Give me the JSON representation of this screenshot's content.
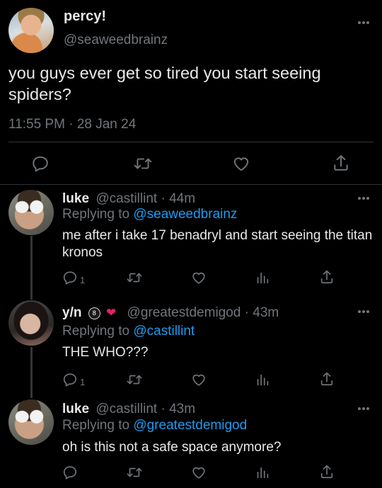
{
  "colors": {
    "background": "#000000",
    "text": "#e7e9ea",
    "muted": "#71767b",
    "link": "#1d9bf0",
    "divider": "#2f3336"
  },
  "main_tweet": {
    "display_name": "percy!",
    "handle": "@seaweedbrainz",
    "text": "you guys ever get so tired you start seeing spiders?",
    "time": "11:55 PM",
    "separator": "·",
    "date": "28 Jan 24",
    "icons": [
      "reply-icon",
      "retweet-icon",
      "like-icon",
      "share-icon"
    ]
  },
  "replies": [
    {
      "display_name": "luke",
      "handle": "@castillint",
      "separator": "·",
      "age": "44m",
      "replying_prefix": "Replying to",
      "replying_to": "@seaweedbrainz",
      "text": "me after i take 17 benadryl and start seeing the titan kronos",
      "reply_count": "1"
    },
    {
      "display_name": "y/n",
      "badge_icons": [
        "8-ball-icon",
        "mending-heart-icon"
      ],
      "badge_glyph": "8",
      "heart_glyph": "❤",
      "handle": "@greatestdemigod",
      "separator": "·",
      "age": "43m",
      "replying_prefix": "Replying to",
      "replying_to": "@castillint",
      "text": "THE WHO???",
      "reply_count": "1"
    },
    {
      "display_name": "luke",
      "handle": "@castillint",
      "separator": "·",
      "age": "43m",
      "replying_prefix": "Replying to",
      "replying_to": "@greatestdemigod",
      "text": "oh is this not a safe space anymore?",
      "reply_count": ""
    }
  ]
}
